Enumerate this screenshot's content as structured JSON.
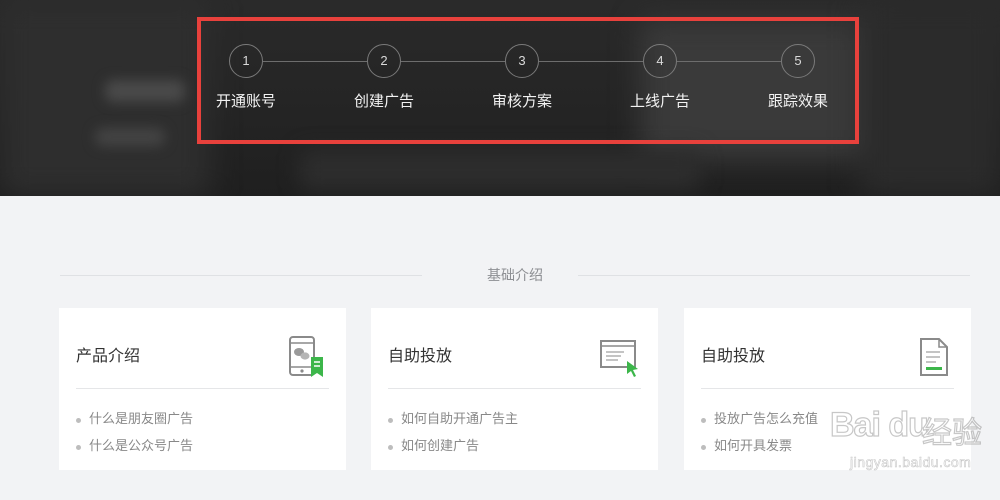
{
  "steps": [
    {
      "number": "1",
      "label": "开通账号"
    },
    {
      "number": "2",
      "label": "创建广告"
    },
    {
      "number": "3",
      "label": "审核方案"
    },
    {
      "number": "4",
      "label": "上线广告"
    },
    {
      "number": "5",
      "label": "跟踪效果"
    }
  ],
  "section": {
    "title": "基础介绍"
  },
  "cards": [
    {
      "title": "产品介绍",
      "icon": "phone-wechat-icon",
      "items": [
        "什么是朋友圈广告",
        "什么是公众号广告"
      ]
    },
    {
      "title": "自助投放",
      "icon": "browser-cursor-icon",
      "items": [
        "如何自助开通广告主",
        "如何创建广告"
      ]
    },
    {
      "title": "自助投放",
      "icon": "document-icon",
      "items": [
        "投放广告怎么充值",
        "如何开具发票"
      ]
    }
  ],
  "watermark": {
    "brand": "Bai du",
    "cn": "经验",
    "url": "jingyan.baidu.com"
  },
  "colors": {
    "highlight": "#e8413c",
    "accent_green": "#3cb64a",
    "hero_bg": "#262626",
    "page_bg": "#f2f3f5"
  }
}
